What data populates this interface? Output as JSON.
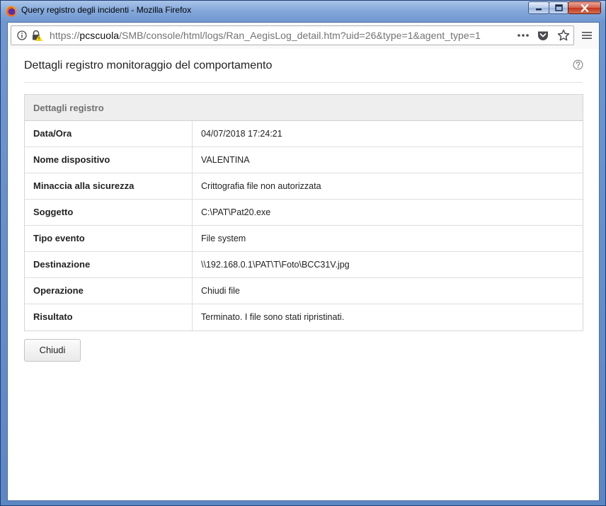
{
  "window": {
    "title": "Query registro degli incidenti - Mozilla Firefox"
  },
  "browser": {
    "url_prefix": "https://",
    "url_host": "pcscuola",
    "url_rest": "/SMB/console/html/logs/Ran_AegisLog_detail.htm?uid=26&type=1&agent_type=1",
    "icons": [
      "info-icon",
      "lock-warning-icon",
      "more-actions-icon",
      "pocket-icon",
      "bookmark-star-icon",
      "menu-icon"
    ]
  },
  "page": {
    "title": "Dettagli registro monitoraggio del comportamento",
    "panel_title": "Dettagli registro",
    "rows": [
      {
        "label": "Data/Ora",
        "value": "04/07/2018 17:24:21"
      },
      {
        "label": "Nome dispositivo",
        "value": "VALENTINA"
      },
      {
        "label": "Minaccia alla sicurezza",
        "value": "Crittografia file non autorizzata"
      },
      {
        "label": "Soggetto",
        "value": "C:\\PAT\\Pat20.exe"
      },
      {
        "label": "Tipo evento",
        "value": "File system"
      },
      {
        "label": "Destinazione",
        "value": "\\\\192.168.0.1\\PAT\\T\\Foto\\BCC31V.jpg"
      },
      {
        "label": "Operazione",
        "value": "Chiudi file"
      },
      {
        "label": "Risultato",
        "value": "Terminato. I file sono stati ripristinati."
      }
    ],
    "close_label": "Chiudi"
  },
  "colors": {
    "window_frame": "#6f96cf",
    "close_button": "#c2351d",
    "panel_header_bg": "#eeeeee"
  }
}
